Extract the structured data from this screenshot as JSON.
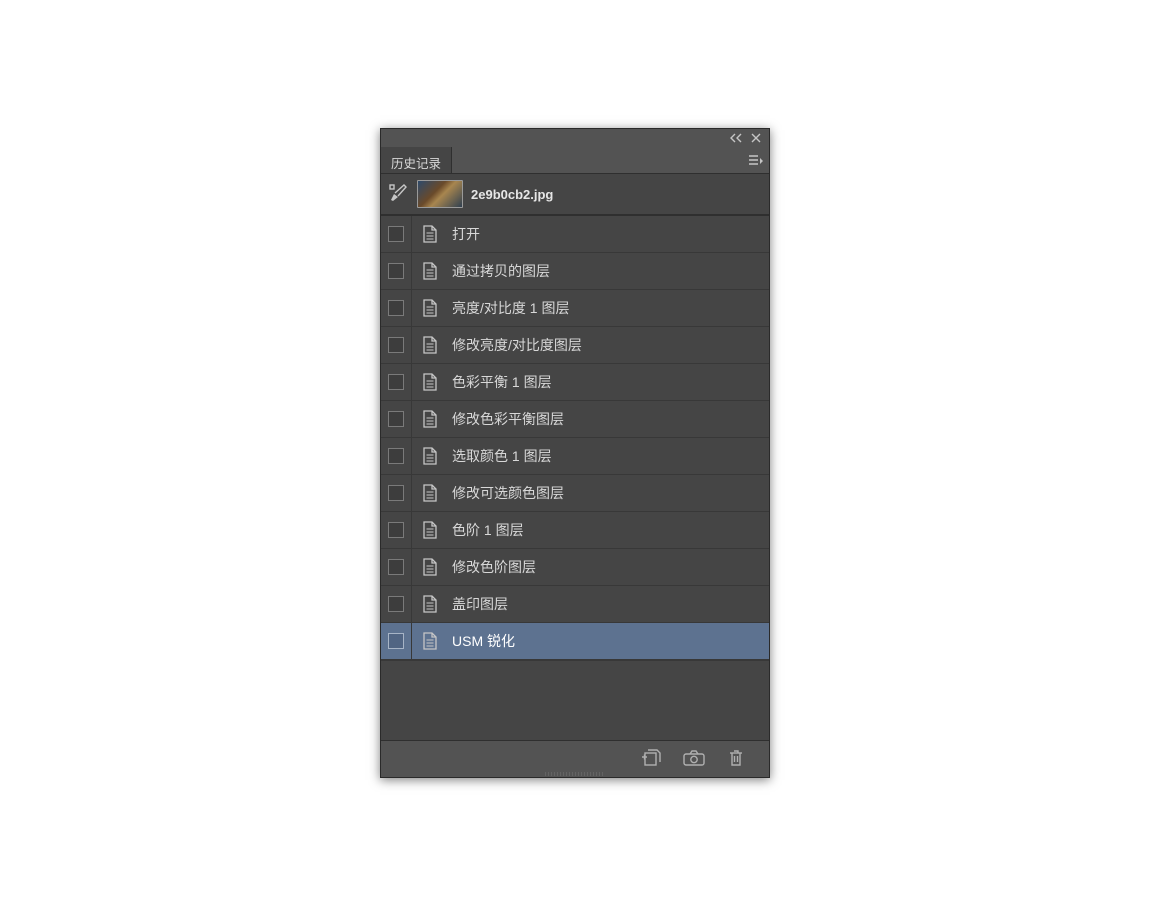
{
  "panel": {
    "tab_label": "历史记录",
    "snapshot_name": "2e9b0cb2.jpg",
    "rows": [
      {
        "label": "打开",
        "selected": false
      },
      {
        "label": "通过拷贝的图层",
        "selected": false
      },
      {
        "label": "亮度/对比度 1 图层",
        "selected": false
      },
      {
        "label": "修改亮度/对比度图层",
        "selected": false
      },
      {
        "label": "色彩平衡 1 图层",
        "selected": false
      },
      {
        "label": "修改色彩平衡图层",
        "selected": false
      },
      {
        "label": "选取颜色 1 图层",
        "selected": false
      },
      {
        "label": "修改可选颜色图层",
        "selected": false
      },
      {
        "label": "色阶 1 图层",
        "selected": false
      },
      {
        "label": "修改色阶图层",
        "selected": false
      },
      {
        "label": "盖印图层",
        "selected": false
      },
      {
        "label": "USM 锐化",
        "selected": true
      }
    ]
  }
}
